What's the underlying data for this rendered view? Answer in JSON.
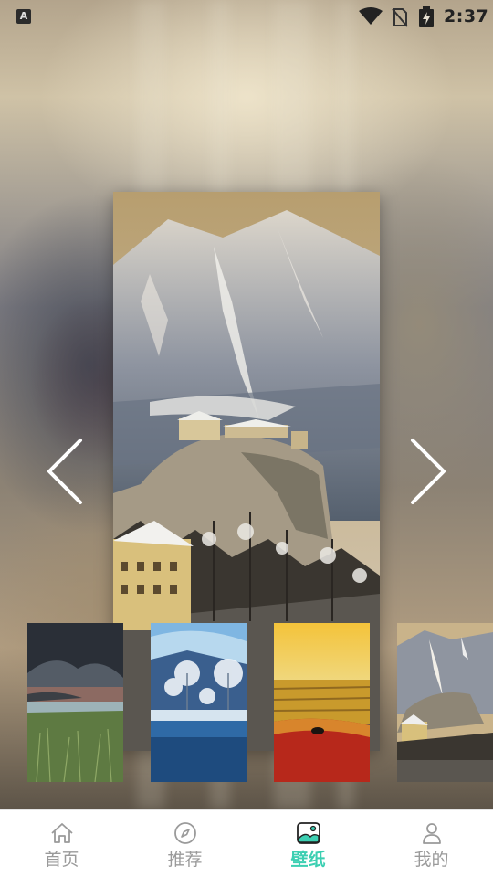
{
  "status_bar": {
    "time": "2:37",
    "icons": [
      "keyboard-a-icon",
      "wifi-icon",
      "no-sim-icon",
      "battery-charging-icon"
    ]
  },
  "arrows": {
    "prev_icon": "chevron-left-icon",
    "next_icon": "chevron-right-icon"
  },
  "thumbnails": [
    {
      "name": "stormy-coast-grass"
    },
    {
      "name": "frosty-lake-trees"
    },
    {
      "name": "golden-sunset-sea"
    },
    {
      "name": "snowy-castle-mountain"
    }
  ],
  "bottom_nav": {
    "items": [
      {
        "label": "首页",
        "icon": "home-icon",
        "active": false
      },
      {
        "label": "推荐",
        "icon": "compass-icon",
        "active": false
      },
      {
        "label": "壁纸",
        "icon": "wallpaper-icon",
        "active": true
      },
      {
        "label": "我的",
        "icon": "person-icon",
        "active": false
      }
    ]
  },
  "colors": {
    "accent": "#3ccfb2",
    "nav_inactive": "#9a9a9a",
    "nav_background": "#ffffff"
  }
}
